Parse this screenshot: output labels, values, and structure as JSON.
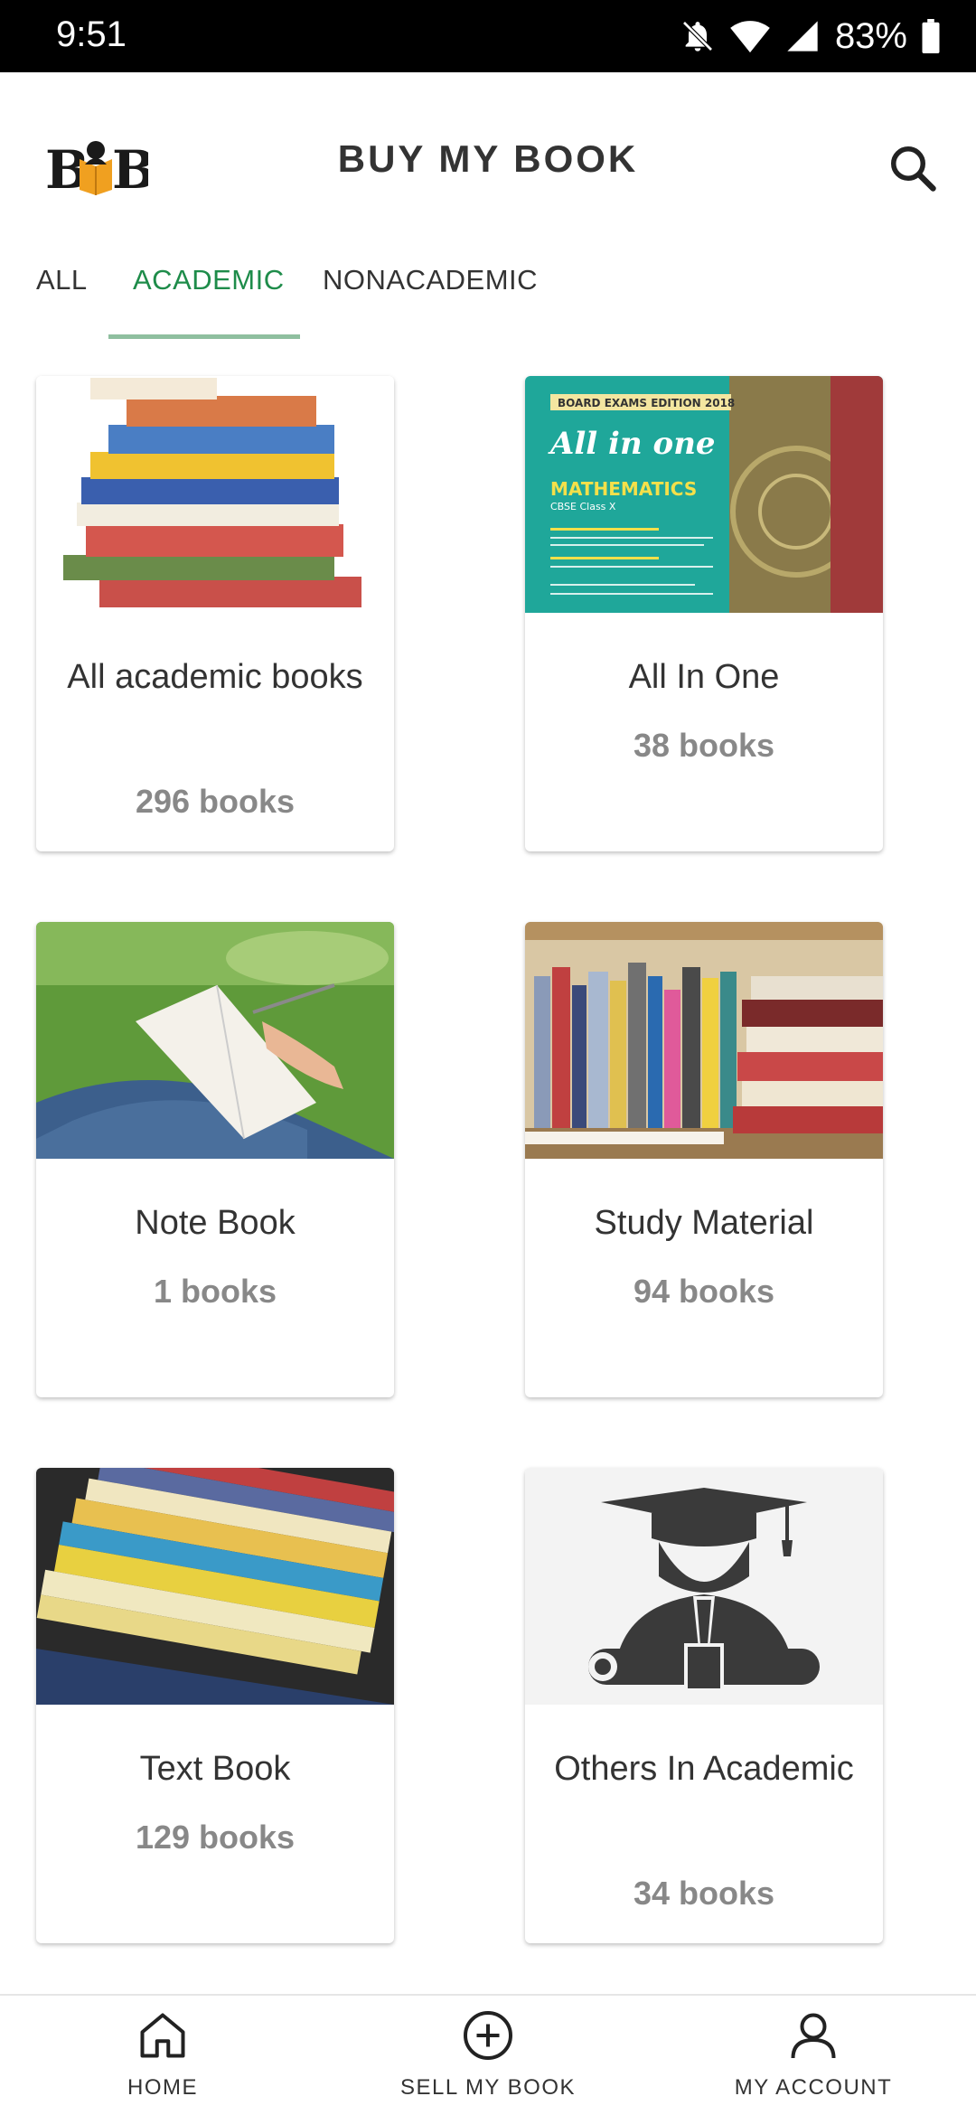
{
  "status_bar": {
    "time": "9:51",
    "battery": "83%"
  },
  "app_bar": {
    "title": "BUY MY BOOK",
    "logo_text": "BOOKB",
    "logo_alt": "BMB"
  },
  "tabs": [
    {
      "label": "ALL",
      "active": false
    },
    {
      "label": "ACADEMIC",
      "active": true
    },
    {
      "label": "NONACADEMIC",
      "active": false
    }
  ],
  "categories": [
    {
      "title": "All academic books",
      "count": "296 books",
      "image": "book-stack-image"
    },
    {
      "title": "All In One",
      "count": "38 books",
      "image": "all-in-one-cover-image"
    },
    {
      "title": "Note Book",
      "count": "1 books",
      "image": "notebook-writing-image"
    },
    {
      "title": "Study Material",
      "count": "94 books",
      "image": "bookshelf-image"
    },
    {
      "title": "Text Book",
      "count": "129 books",
      "image": "textbook-stack-image"
    },
    {
      "title": "Others In Academic",
      "count": "34 books",
      "image": "graduate-icon-image"
    }
  ],
  "cover_text": {
    "banner": "BOARD EXAMS EDITION 2018",
    "brand": "All in one",
    "subject": "MATHEMATICS",
    "class": "CBSE Class X"
  },
  "bottom_nav": [
    {
      "label": "HOME",
      "icon": "home-icon"
    },
    {
      "label": "SELL MY BOOK",
      "icon": "plus-circle-icon"
    },
    {
      "label": "MY ACCOUNT",
      "icon": "person-icon"
    }
  ],
  "colors": {
    "accent": "#1e8c4a",
    "indicator": "#8fbf9f",
    "status_bar": "#000000"
  }
}
